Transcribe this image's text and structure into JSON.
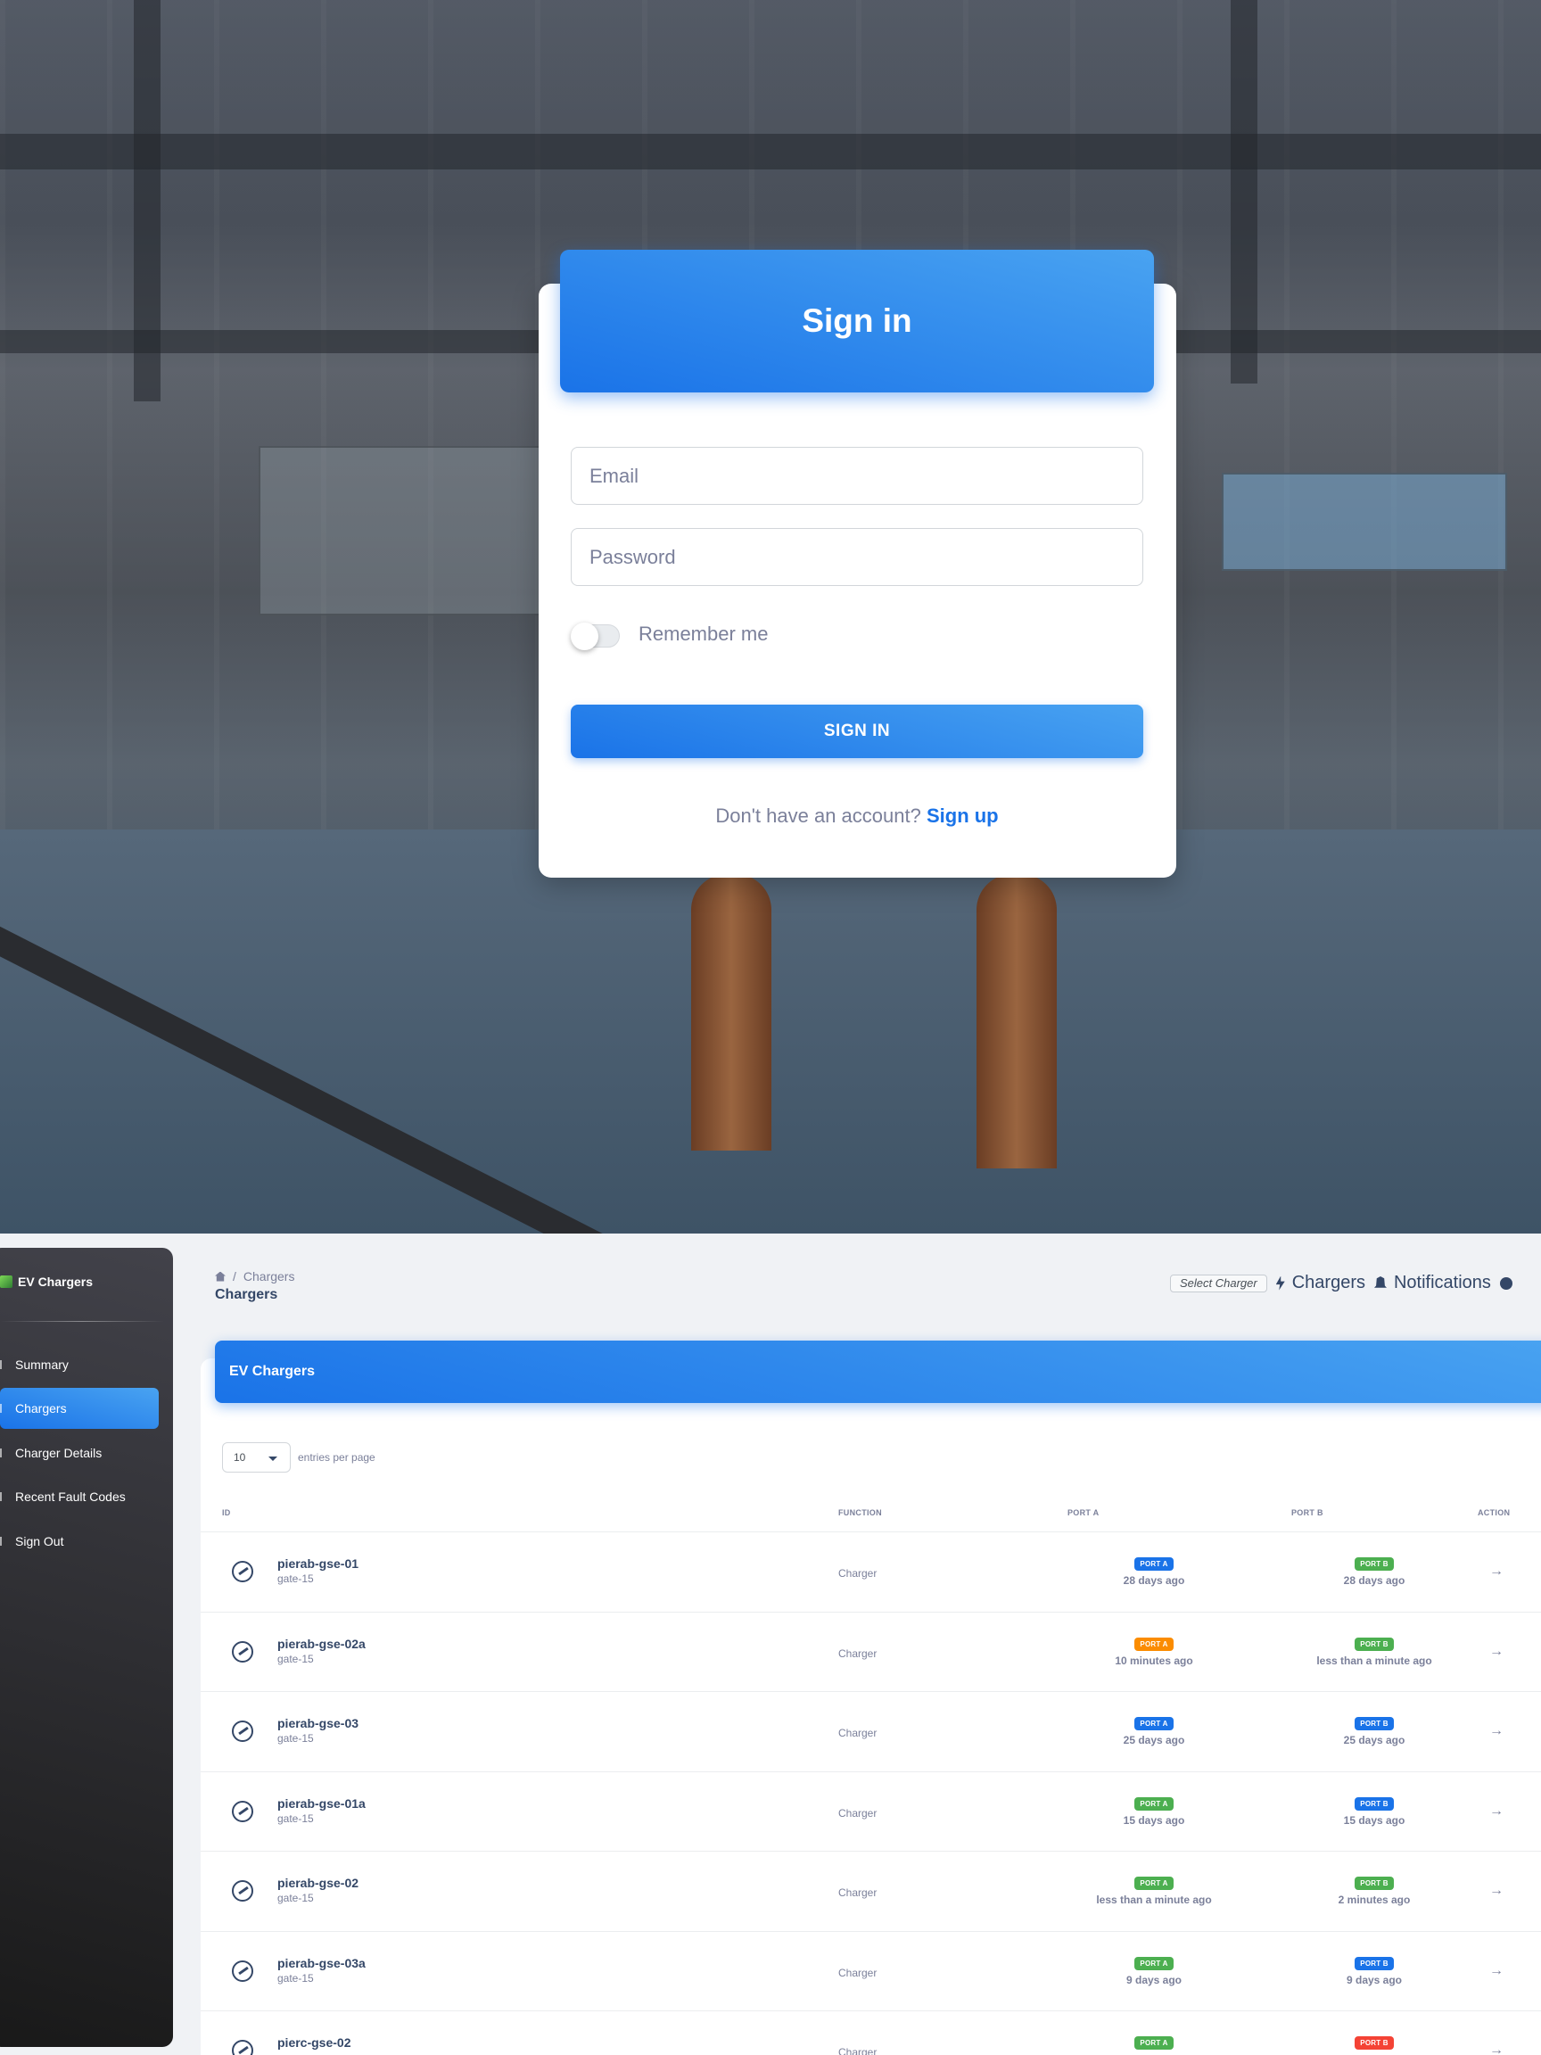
{
  "signin": {
    "title": "Sign in",
    "email_placeholder": "Email",
    "password_placeholder": "Password",
    "remember_label": "Remember me",
    "remember_checked": false,
    "submit_label": "SIGN IN",
    "no_account_text": "Don't have an account?",
    "signup_link": "Sign up"
  },
  "sidebar": {
    "brand": "EV Chargers",
    "items": [
      {
        "label": "Summary",
        "active": false
      },
      {
        "label": "Chargers",
        "active": true
      },
      {
        "label": "Charger Details",
        "active": false
      },
      {
        "label": "Recent Fault Codes",
        "active": false
      },
      {
        "label": "Sign Out",
        "active": false
      }
    ]
  },
  "breadcrumb": {
    "current": "Chargers",
    "title": "Chargers"
  },
  "topbar": {
    "select_placeholder": "Select Charger",
    "chargers_label": "Chargers",
    "notifications_label": "Notifications"
  },
  "table": {
    "title": "EV Chargers",
    "entries_value": "10",
    "entries_label": "entries per page",
    "headers": {
      "id": "ID",
      "function": "FUNCTION",
      "port_a": "PORT A",
      "port_b": "PORT B",
      "action": "ACTION"
    },
    "colors": {
      "blue": "#1a73e8",
      "green": "#4caf50",
      "orange": "#fb8c00",
      "red": "#f44335"
    },
    "rows": [
      {
        "id": "pierab-gse-01",
        "gate": "gate-15",
        "function": "Charger",
        "port_a": {
          "label": "PORT A",
          "color": "blue",
          "when": "28 days ago"
        },
        "port_b": {
          "label": "PORT B",
          "color": "green",
          "when": "28 days ago"
        }
      },
      {
        "id": "pierab-gse-02a",
        "gate": "gate-15",
        "function": "Charger",
        "port_a": {
          "label": "PORT A",
          "color": "orange",
          "when": "10 minutes ago"
        },
        "port_b": {
          "label": "PORT B",
          "color": "green",
          "when": "less than a minute ago"
        }
      },
      {
        "id": "pierab-gse-03",
        "gate": "gate-15",
        "function": "Charger",
        "port_a": {
          "label": "PORT A",
          "color": "blue",
          "when": "25 days ago"
        },
        "port_b": {
          "label": "PORT B",
          "color": "blue",
          "when": "25 days ago"
        }
      },
      {
        "id": "pierab-gse-01a",
        "gate": "gate-15",
        "function": "Charger",
        "port_a": {
          "label": "PORT A",
          "color": "green",
          "when": "15 days ago"
        },
        "port_b": {
          "label": "PORT B",
          "color": "blue",
          "when": "15 days ago"
        }
      },
      {
        "id": "pierab-gse-02",
        "gate": "gate-15",
        "function": "Charger",
        "port_a": {
          "label": "PORT A",
          "color": "green",
          "when": "less than a minute ago"
        },
        "port_b": {
          "label": "PORT B",
          "color": "green",
          "when": "2 minutes ago"
        }
      },
      {
        "id": "pierab-gse-03a",
        "gate": "gate-15",
        "function": "Charger",
        "port_a": {
          "label": "PORT A",
          "color": "green",
          "when": "9 days ago"
        },
        "port_b": {
          "label": "PORT B",
          "color": "blue",
          "when": "9 days ago"
        }
      },
      {
        "id": "pierc-gse-02",
        "gate": "",
        "function": "Charger",
        "port_a": {
          "label": "PORT A",
          "color": "green",
          "when": ""
        },
        "port_b": {
          "label": "PORT B",
          "color": "red",
          "when": ""
        }
      }
    ],
    "action_symbol": "→"
  }
}
